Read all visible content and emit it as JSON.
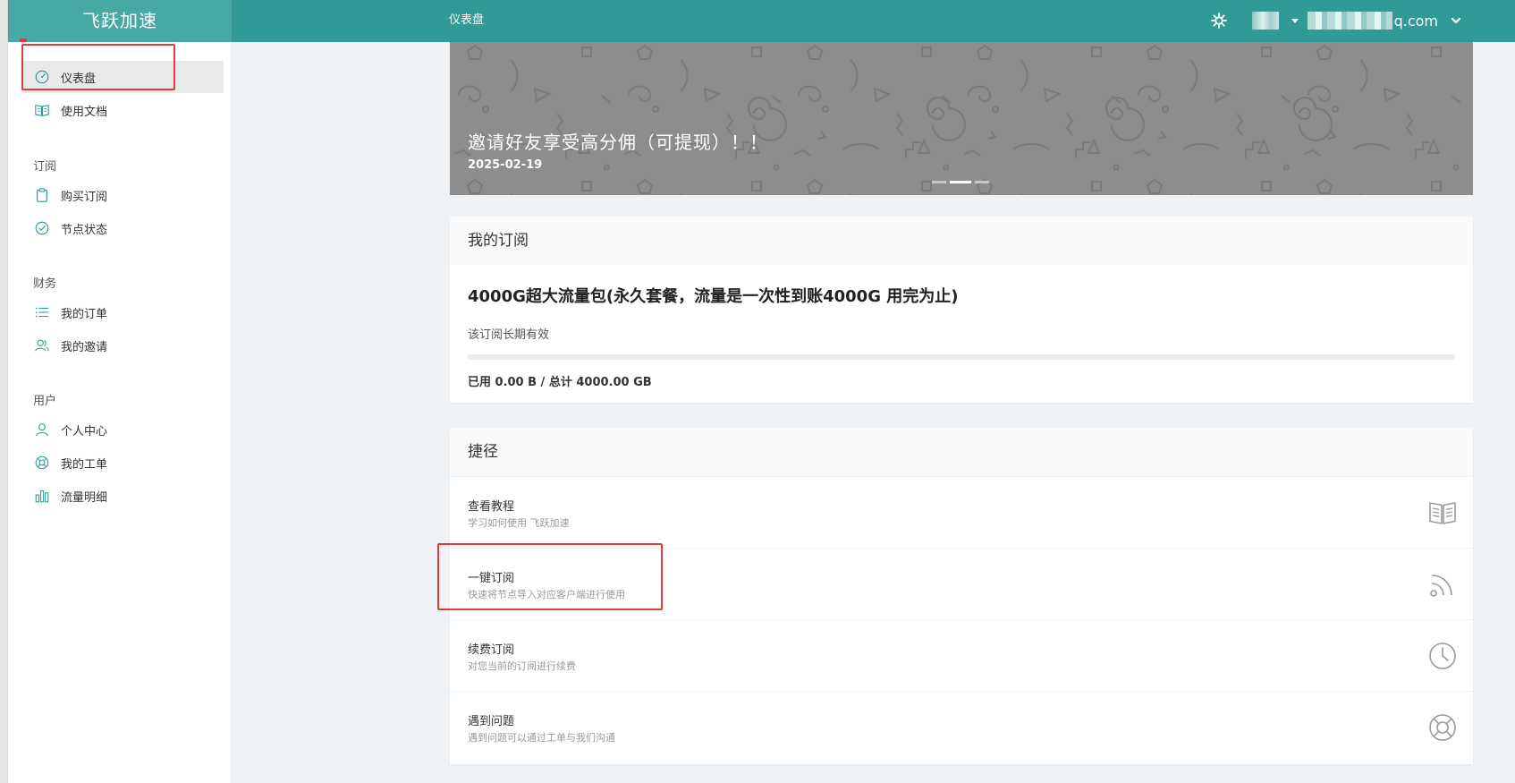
{
  "app": {
    "brand": "飞跃加速",
    "page_title": "仪表盘",
    "user_email_visible": "q.com"
  },
  "sidebar": {
    "items_top": [
      {
        "label": "仪表盘",
        "icon": "dashboard-icon",
        "active": true
      },
      {
        "label": "使用文档",
        "icon": "book-icon"
      }
    ],
    "sections": [
      {
        "title": "订阅",
        "items": [
          {
            "label": "购买订阅",
            "icon": "clipboard-icon"
          },
          {
            "label": "节点状态",
            "icon": "check-circle-icon"
          }
        ]
      },
      {
        "title": "财务",
        "items": [
          {
            "label": "我的订单",
            "icon": "list-icon"
          },
          {
            "label": "我的邀请",
            "icon": "users-icon"
          }
        ]
      },
      {
        "title": "用户",
        "items": [
          {
            "label": "个人中心",
            "icon": "user-icon"
          },
          {
            "label": "我的工单",
            "icon": "lifebuoy-icon"
          },
          {
            "label": "流量明细",
            "icon": "bar-chart-icon"
          }
        ]
      }
    ]
  },
  "banner": {
    "title": "邀请好友享受高分佣（可提现）！！",
    "date": "2025-02-19",
    "slides": 3,
    "active_slide": 2
  },
  "subscription": {
    "heading": "我的订阅",
    "plan_name": "4000G超大流量包(永久套餐，流量是一次性到账4000G 用完为止)",
    "validity": "该订阅长期有效",
    "usage_text": "已用 0.00 B / 总计 4000.00 GB",
    "used_fraction": 0
  },
  "shortcuts": {
    "heading": "捷径",
    "items": [
      {
        "title": "查看教程",
        "desc": "学习如何使用 飞跃加速",
        "icon": "book-icon"
      },
      {
        "title": "一键订阅",
        "desc": "快速将节点导入对应客户端进行使用",
        "icon": "rss-icon"
      },
      {
        "title": "续费订阅",
        "desc": "对您当前的订阅进行续费",
        "icon": "clock-icon"
      },
      {
        "title": "遇到问题",
        "desc": "遇到问题可以通过工单与我们沟通",
        "icon": "lifebuoy-icon"
      }
    ]
  },
  "colors": {
    "header": "#2f9a96",
    "brand": "#47a8a4",
    "icon": "#2f9a96",
    "highlight": "#e53935"
  }
}
